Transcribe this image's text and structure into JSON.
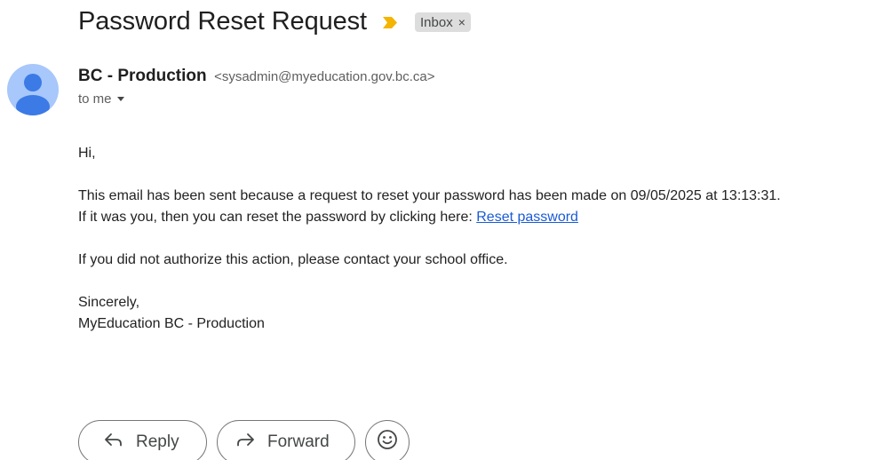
{
  "email": {
    "subject": "Password Reset Request",
    "label": "Inbox",
    "label_remove": "×",
    "sender_name": "BC - Production",
    "sender_email": "<sysadmin@myeducation.gov.bc.ca>",
    "to_text": "to me",
    "body": {
      "greeting": "Hi,",
      "line1": "This email has been sent because a request to reset your password has been made on 09/05/2025 at 13:13:31.",
      "line2_prefix": "If it was you, then you can reset the password by clicking here: ",
      "link_text": "Reset password",
      "line3": "If you did not authorize this action, please contact your school office.",
      "signoff": "Sincerely,",
      "signature": "MyEducation BC - Production"
    }
  },
  "actions": {
    "reply_label": "Reply",
    "forward_label": "Forward"
  },
  "icons": {
    "importance": "importance-marker-icon",
    "avatar": "person-icon",
    "reply": "reply-arrow-icon",
    "forward": "forward-arrow-icon",
    "emoji": "emoji-smile-icon"
  },
  "colors": {
    "importance": "#f4b400",
    "avatar_bg": "#a8c7fa",
    "avatar_fg": "#3c7ae6",
    "link": "#1a5bd6",
    "chip_bg": "#dddddd"
  }
}
